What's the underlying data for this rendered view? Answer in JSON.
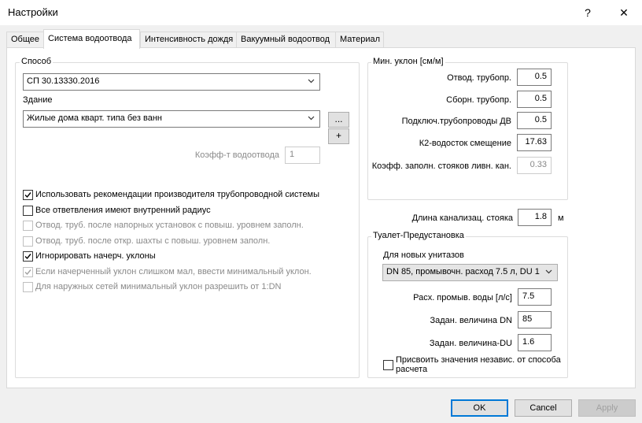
{
  "window": {
    "title": "Настройки",
    "help_glyph": "?",
    "close_glyph": "✕"
  },
  "tabs": [
    "Общее",
    "Система водоотвода",
    "Интенсивность дождя",
    "Вакуумный водоотвод",
    "Материал"
  ],
  "left": {
    "method_legend": "Способ",
    "method_value": "СП 30.13330.2016",
    "building_label": "Здание",
    "building_value": "Жилые дома кварт. типа без ванн",
    "ellipsis_label": "...",
    "plus_label": "+",
    "coef_label": "Коэфф-т водоотвода",
    "coef_value": "1",
    "checks": [
      {
        "label": "Использовать рекомендации производителя трубопроводной системы",
        "checked": true,
        "enabled": true
      },
      {
        "label": "Все ответвления имеют внутренний радиус",
        "checked": false,
        "enabled": true
      },
      {
        "label": "Отвод. труб. после напорных установок с повыш. уровнем заполн.",
        "checked": false,
        "enabled": false
      },
      {
        "label": "Отвод. труб. после откр. шахты с повыш. уровнем заполн.",
        "checked": false,
        "enabled": false
      },
      {
        "label": "Игнорировать начерч. уклоны",
        "checked": true,
        "enabled": true
      },
      {
        "label": "Если начерченный уклон слишком мал, ввести минимальный уклон.",
        "checked": true,
        "enabled": false
      },
      {
        "label": "Для наружных сетей минимальный уклон разрешить от 1:DN",
        "checked": false,
        "enabled": false
      }
    ]
  },
  "slope": {
    "legend": "Мин. уклон [см/м]",
    "rows": [
      {
        "label": "Отвод. трубопр.",
        "value": "0.5"
      },
      {
        "label": "Сборн. трубопр.",
        "value": "0.5"
      },
      {
        "label": "Подключ.трубопроводы ДВ",
        "value": "0.5"
      },
      {
        "label": "К2-водосток смещение",
        "value": "17.63"
      },
      {
        "label": "Коэфф. заполн. стояков ливн. кан.",
        "value": "0.33"
      }
    ]
  },
  "sewer": {
    "label": "Длина канализац. стояка",
    "value": "1.8",
    "unit": "м"
  },
  "toilet": {
    "legend": "Туалет-Предустановка",
    "new_label": "Для новых унитазов",
    "new_value": "DN  85, промывочн. расход 7.5 л, DU 1",
    "rows": [
      {
        "label": "Расх. промыв. воды [л/с]",
        "value": "7.5"
      },
      {
        "label": "Задан. величина DN",
        "value": "85"
      },
      {
        "label": "Задан. величина-DU",
        "value": "1.6"
      }
    ],
    "assign_label": "Присвоить значения независ. от способа расчета"
  },
  "buttons": {
    "ok": "OK",
    "cancel": "Cancel",
    "apply": "Apply"
  }
}
